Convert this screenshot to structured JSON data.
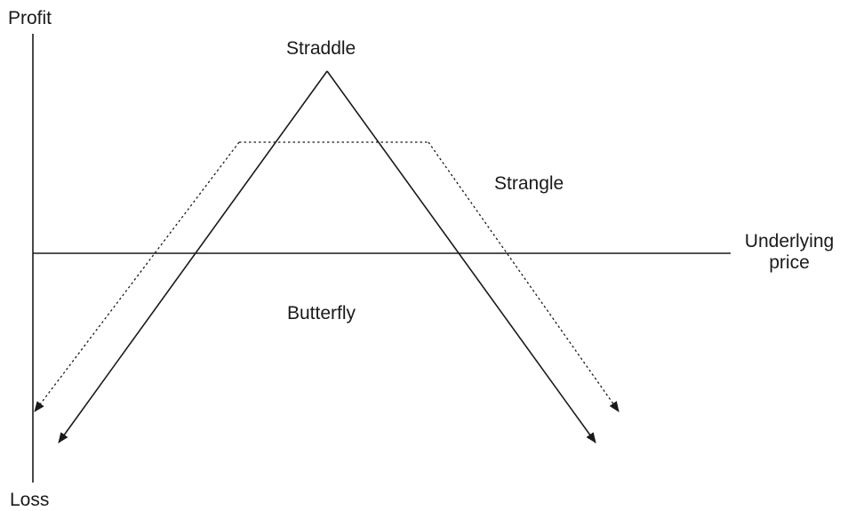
{
  "axes": {
    "y_top_label": "Profit",
    "y_bottom_label": "Loss",
    "x_label_line1": "Underlying",
    "x_label_line2": "price"
  },
  "strategies": {
    "straddle": "Straddle",
    "strangle": "Strangle",
    "butterfly": "Butterfly"
  },
  "colors": {
    "ink": "#1a1a1a",
    "background": "#ffffff"
  }
}
